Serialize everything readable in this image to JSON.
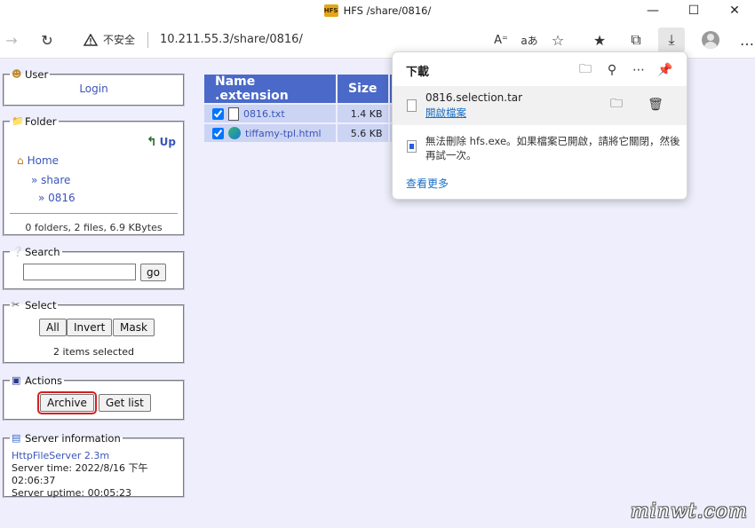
{
  "window": {
    "title": "HFS /share/0816/",
    "logo_text": "HFS"
  },
  "toolbar": {
    "security_label": "不安全",
    "url": "10.211.55.3/share/0816/"
  },
  "sidebar": {
    "user": {
      "legend": "User",
      "login": "Login"
    },
    "folder": {
      "legend": "Folder",
      "up": "Up",
      "breadcrumbs": [
        "Home",
        "» share",
        "» 0816"
      ],
      "summary": "0 folders, 2 files, 6.9 KBytes"
    },
    "search": {
      "legend": "Search",
      "value": "",
      "go": "go"
    },
    "select": {
      "legend": "Select",
      "all": "All",
      "invert": "Invert",
      "mask": "Mask",
      "status": "2 items selected"
    },
    "actions": {
      "legend": "Actions",
      "archive": "Archive",
      "get_list": "Get list"
    },
    "server": {
      "legend": "Server information",
      "name": "HttpFileServer 2.3m",
      "time": "Server time: 2022/8/16 下午 02:06:37",
      "uptime": "Server uptime: 00:05:23"
    }
  },
  "files": {
    "headers": [
      "Name .extension",
      "Size"
    ],
    "rows": [
      {
        "name": "0816.txt",
        "size": "1.4 KB",
        "checked": true
      },
      {
        "name": "tiffamy-tpl.html",
        "size": "5.6 KB",
        "checked": true
      }
    ]
  },
  "downloads": {
    "title": "下載",
    "item_name": "0816.selection.tar",
    "open_file": "開啟檔案",
    "error": "無法刪除 hfs.exe。如果檔案已開啟，請將它關閉，然後再試一次。",
    "see_more": "查看更多"
  },
  "watermark": "minwt.com",
  "colors": {
    "page_bg": "#eeeefc",
    "header_bg": "#4a69c8",
    "row_bg": "#ccd4f4",
    "link": "#3b55b8",
    "archive_border": "#d42020"
  }
}
